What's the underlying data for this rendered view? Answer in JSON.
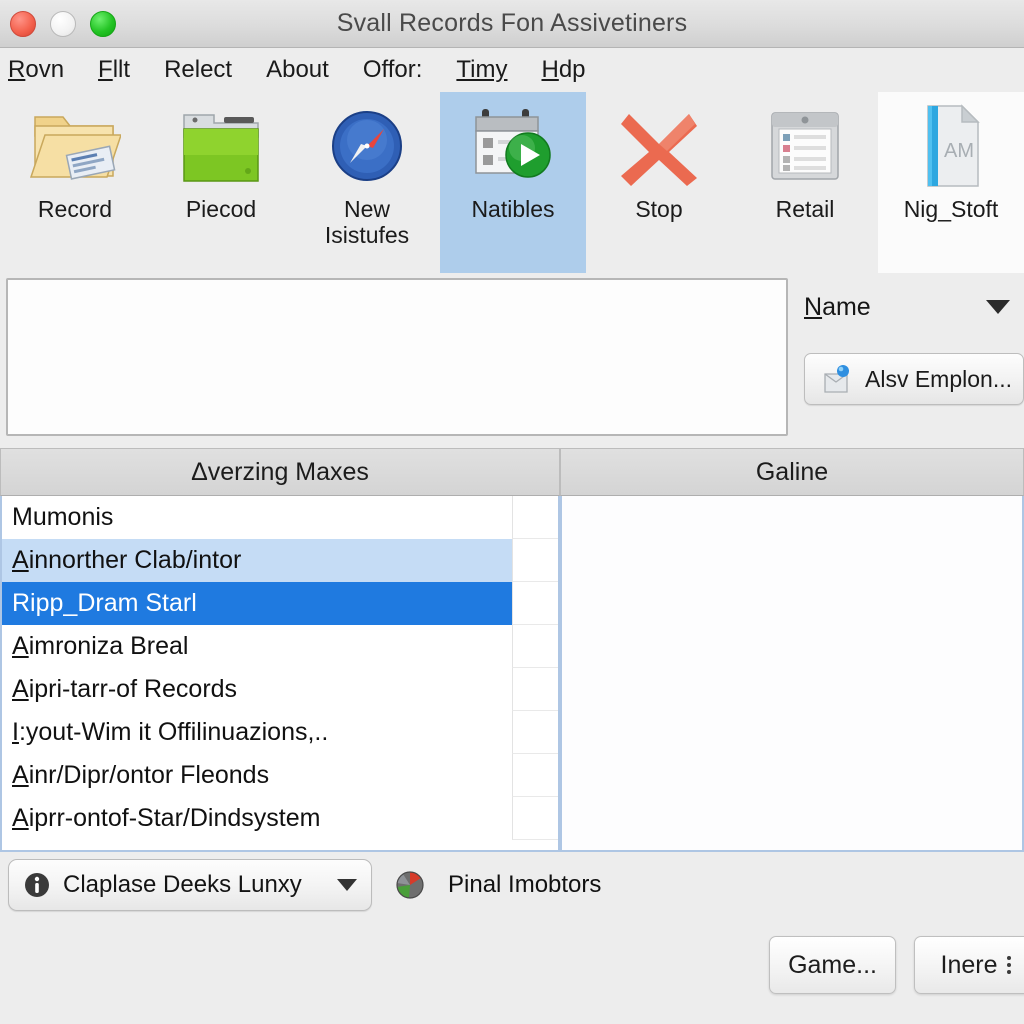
{
  "window": {
    "title": "Svall Records Fon Assivetiners",
    "controls": [
      {
        "name": "close",
        "color": "#f4634f"
      },
      {
        "name": "minimize",
        "color": "#f2f2f2"
      },
      {
        "name": "zoom",
        "color": "#24c425"
      }
    ]
  },
  "menubar": {
    "items": [
      {
        "label": "Rovn",
        "mnemonic": "R"
      },
      {
        "label": "Fllt",
        "mnemonic": "F"
      },
      {
        "label": "Relect",
        "mnemonic": ""
      },
      {
        "label": "About",
        "mnemonic": ""
      },
      {
        "label": "Offor:",
        "mnemonic": ""
      },
      {
        "label": "Timy",
        "mnemonic": "all"
      },
      {
        "label": "Hdp",
        "mnemonic": "H"
      }
    ]
  },
  "toolbar": {
    "buttons": [
      {
        "label": "Record",
        "icon": "open-folder-icon",
        "state": "normal"
      },
      {
        "label": "Piecod",
        "icon": "green-folder-icon",
        "state": "normal"
      },
      {
        "label": "New\nIsistufes",
        "icon": "compass-icon",
        "state": "normal"
      },
      {
        "label": "Natibles",
        "icon": "calendar-play-icon",
        "state": "selected"
      },
      {
        "label": "Stop",
        "icon": "red-x-icon",
        "state": "normal"
      },
      {
        "label": "Retail",
        "icon": "window-list-icon",
        "state": "normal"
      },
      {
        "label": "Nig_Stoft",
        "icon": "document-am-icon",
        "state": "card"
      }
    ],
    "selected_background": "#aecdeb"
  },
  "editor": {
    "value": "",
    "placeholder": ""
  },
  "rail": {
    "sort_label": "Name",
    "sort_mnemonic": "N",
    "dropdown_icon": "chevron-down-icon",
    "action_button": {
      "label": "Alsv Emplon...",
      "icon": "blue-pin-box-icon"
    }
  },
  "lists": {
    "left": {
      "header": "Δverzing Maxes",
      "rows": [
        {
          "label": "Mumonis",
          "mnemonic": "",
          "state": "normal"
        },
        {
          "label": "Ainnorther Clab/intor",
          "mnemonic": "A",
          "state": "hover"
        },
        {
          "label": "Ripp_Dram Starl",
          "mnemonic": "",
          "state": "selected"
        },
        {
          "label": "Aimroniza Breal",
          "mnemonic": "A",
          "state": "normal"
        },
        {
          "label": "Aipri-tarr-of Records",
          "mnemonic": "A",
          "state": "normal"
        },
        {
          "label": "I:yout-Wim it Offilinuazions,..",
          "mnemonic": "I",
          "state": "normal"
        },
        {
          "label": "Ainr/Dipr/ontor Fleonds",
          "mnemonic": "A",
          "state": "normal"
        },
        {
          "label": "Aiprr-ontof-Star/Dindsystem",
          "mnemonic": "A",
          "state": "normal"
        }
      ],
      "selected_color": "#1f7ae0",
      "hover_color": "#c5dcf5"
    },
    "right": {
      "header": "Galine",
      "rows": []
    }
  },
  "footer": {
    "combo": {
      "label": "Claplase Deeks Lunxy",
      "icon": "info-icon",
      "caret": "chevron-down-icon"
    },
    "status": {
      "label": "Pinal Imobtors",
      "icon": "color-sphere-icon"
    },
    "buttons": [
      {
        "label": "Game...",
        "icon": ""
      },
      {
        "label": "Inere",
        "icon": "kebab-menu-icon"
      }
    ]
  }
}
